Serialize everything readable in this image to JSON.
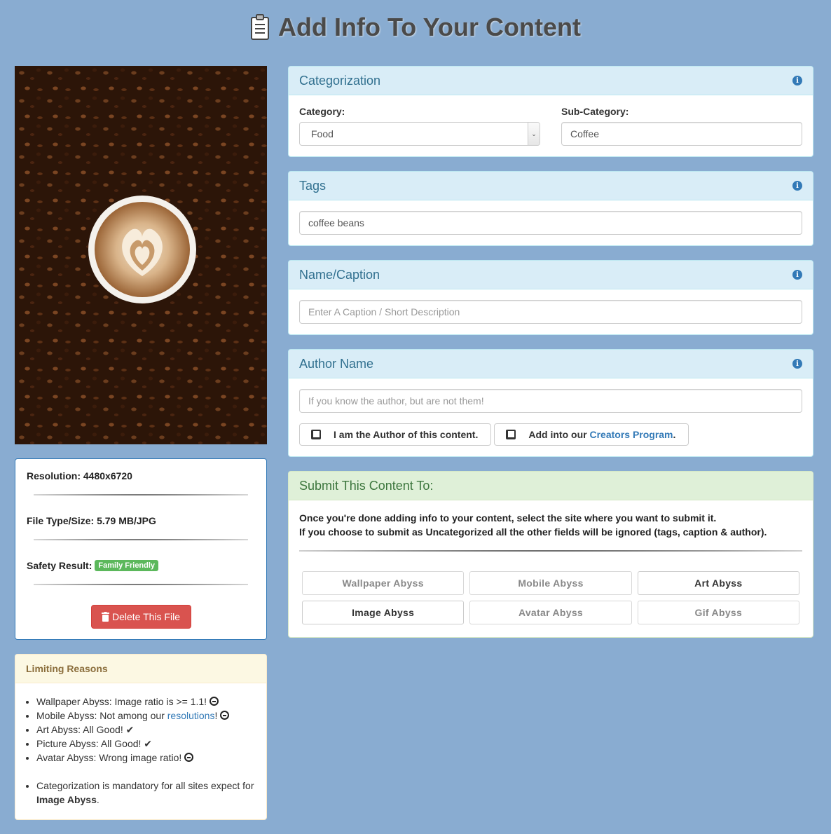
{
  "header": {
    "title": "Add Info To Your Content"
  },
  "file": {
    "resolution": "Resolution: 4480x6720",
    "filetype": "File Type/Size: 5.79 MB/JPG",
    "safety_label": "Safety Result:",
    "safety_badge": "Family Friendly",
    "delete_label": "Delete This File"
  },
  "limiting": {
    "title": "Limiting Reasons",
    "items": [
      {
        "text": "Wallpaper Abyss: Image ratio is >= 1.1!"
      },
      {
        "text_before": "Mobile Abyss: Not among our ",
        "link": "resolutions",
        "text_after": "!"
      },
      {
        "text": "Art Abyss: All Good!"
      },
      {
        "text": "Picture Abyss: All Good!"
      },
      {
        "text": "Avatar Abyss: Wrong image ratio!"
      }
    ],
    "note_before": "Categorization is mandatory for all sites expect for ",
    "note_bold": "Image Abyss",
    "note_after": "."
  },
  "categorization": {
    "title": "Categorization",
    "category_label": "Category:",
    "category_value": "Food",
    "subcategory_label": "Sub-Category:",
    "subcategory_value": "Coffee"
  },
  "tags": {
    "title": "Tags",
    "value": "coffee beans"
  },
  "caption": {
    "title": "Name/Caption",
    "placeholder": "Enter A Caption / Short Description"
  },
  "author": {
    "title": "Author Name",
    "placeholder": "If you know the author, but are not them!",
    "check_author": "I am the Author of this content.",
    "check_creators_before": "Add into our ",
    "check_creators_link": "Creators Program",
    "check_creators_after": "."
  },
  "submit": {
    "title": "Submit This Content To:",
    "line1": "Once you're done adding info to your content, select the site where you want to submit it.",
    "line2": "If you choose to submit as Uncategorized all the other fields will be ignored (tags, caption & author).",
    "sites": [
      {
        "label": "Wallpaper Abyss",
        "enabled": false
      },
      {
        "label": "Mobile Abyss",
        "enabled": false
      },
      {
        "label": "Art Abyss",
        "enabled": true
      },
      {
        "label": "Image Abyss",
        "enabled": true
      },
      {
        "label": "Avatar Abyss",
        "enabled": false
      },
      {
        "label": "Gif Abyss",
        "enabled": false
      }
    ]
  },
  "colors": {
    "background": "#89acd1",
    "info_heading": "#d9edf7",
    "success_heading": "#dff0d8",
    "danger": "#d9534f",
    "badge": "#5cb85c",
    "link": "#337ab7"
  }
}
